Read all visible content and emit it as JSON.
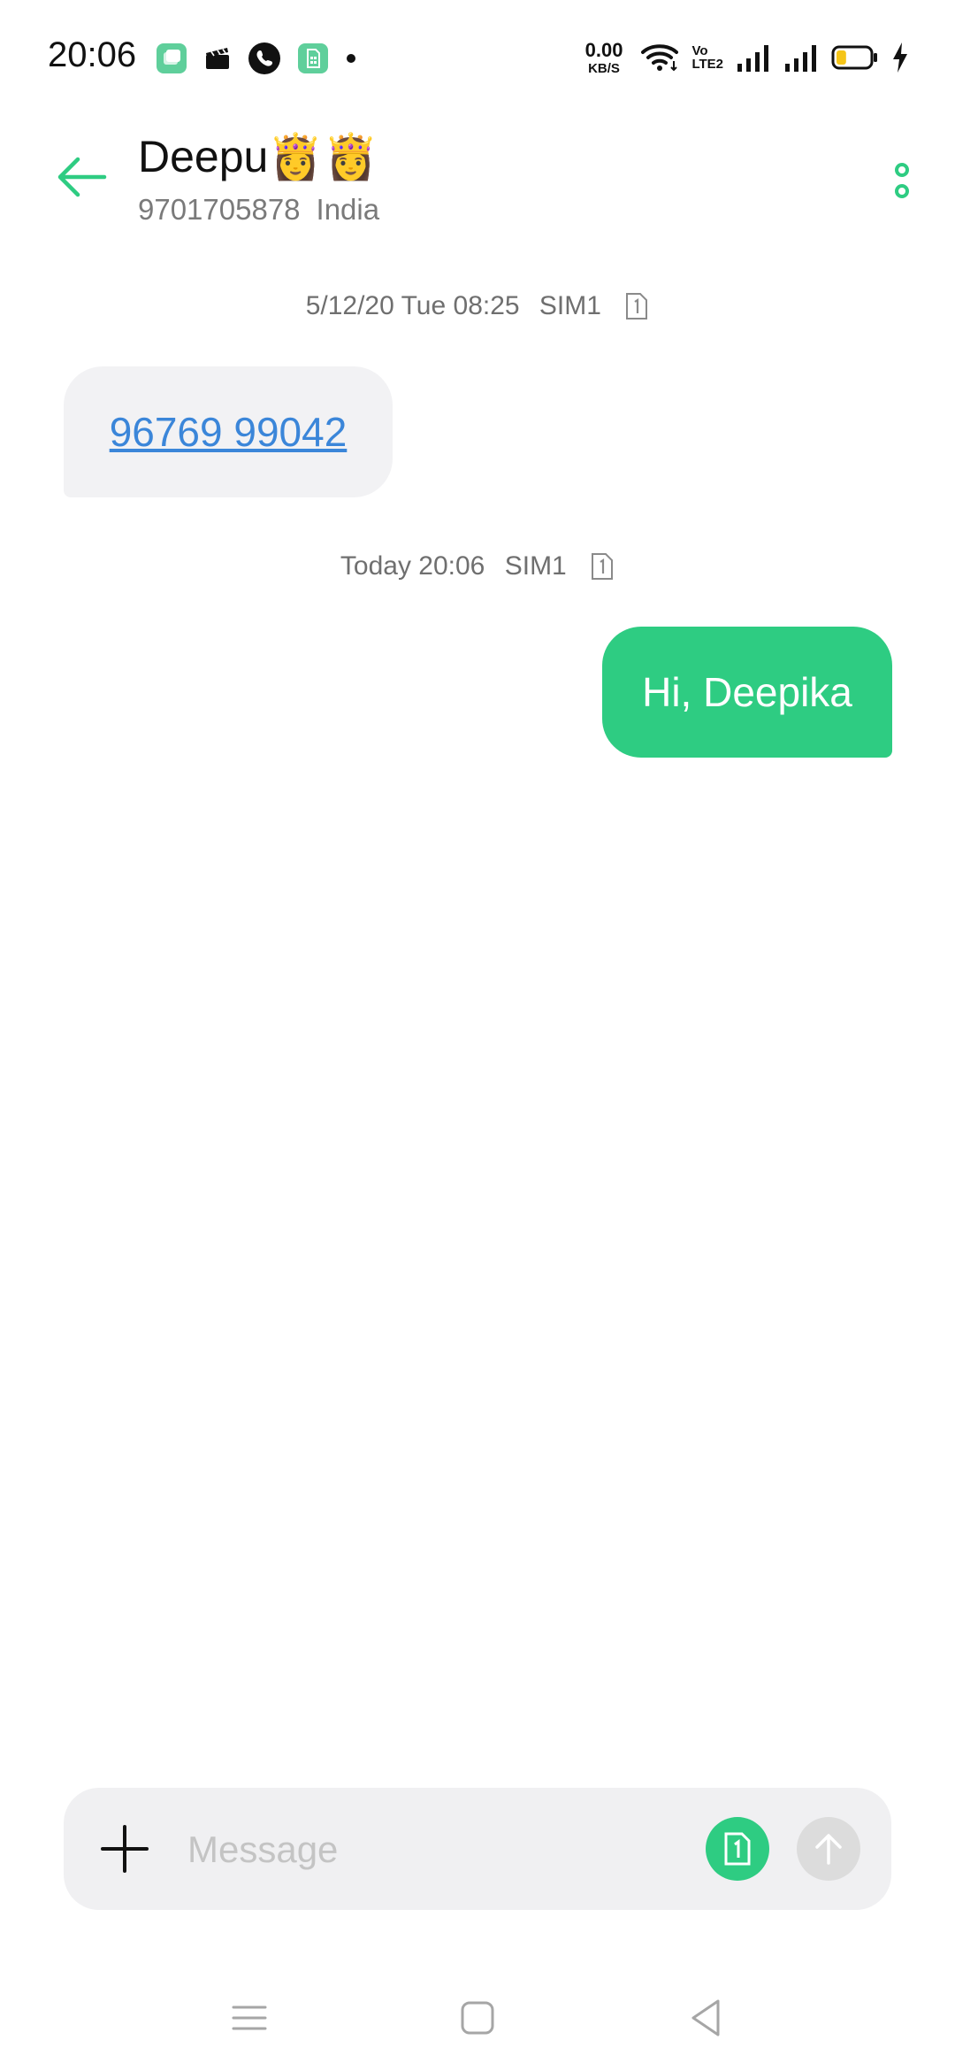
{
  "status_bar": {
    "time": "20:06",
    "net_speed_value": "0.00",
    "net_speed_unit": "KB/S",
    "volte_top": "Vo",
    "volte_bottom": "LTE2",
    "left_icons": [
      "app-icon",
      "clapper-icon",
      "phone-call-icon",
      "sim-app-icon",
      "notification-dot-icon"
    ],
    "right_icons": [
      "wifi-icon",
      "signal-sim1-icon",
      "signal-sim2-icon",
      "battery-icon",
      "charging-icon"
    ],
    "battery_level": 0.3,
    "colors": {
      "battery_fill": "#f5c518",
      "app_icon": "#5fcf9b"
    }
  },
  "header": {
    "contact_name": "Deepu👸👸",
    "phone_number": "9701705878",
    "country": "India",
    "back_icon": "back-arrow-icon",
    "more_icon": "more-options-icon",
    "accent_color": "#2ecc82"
  },
  "conversation": {
    "messages": [
      {
        "timestamp": "5/12/20 Tue 08:25",
        "sim": "SIM1",
        "direction": "incoming",
        "text": "96769 99042",
        "is_link": true
      },
      {
        "timestamp": "Today 20:06",
        "sim": "SIM1",
        "direction": "outgoing",
        "text": "Hi, Deepika",
        "is_link": false
      }
    ],
    "colors": {
      "incoming_bubble": "#f2f2f4",
      "outgoing_bubble": "#2ecc82",
      "link": "#3b86d9"
    }
  },
  "composer": {
    "placeholder": "Message",
    "value": "",
    "attach_icon": "plus-icon",
    "sim_icon": "sim-card-1-icon",
    "send_icon": "send-arrow-icon"
  },
  "nav_bar": {
    "icons": [
      "menu-icon",
      "home-icon",
      "back-triangle-icon"
    ]
  }
}
